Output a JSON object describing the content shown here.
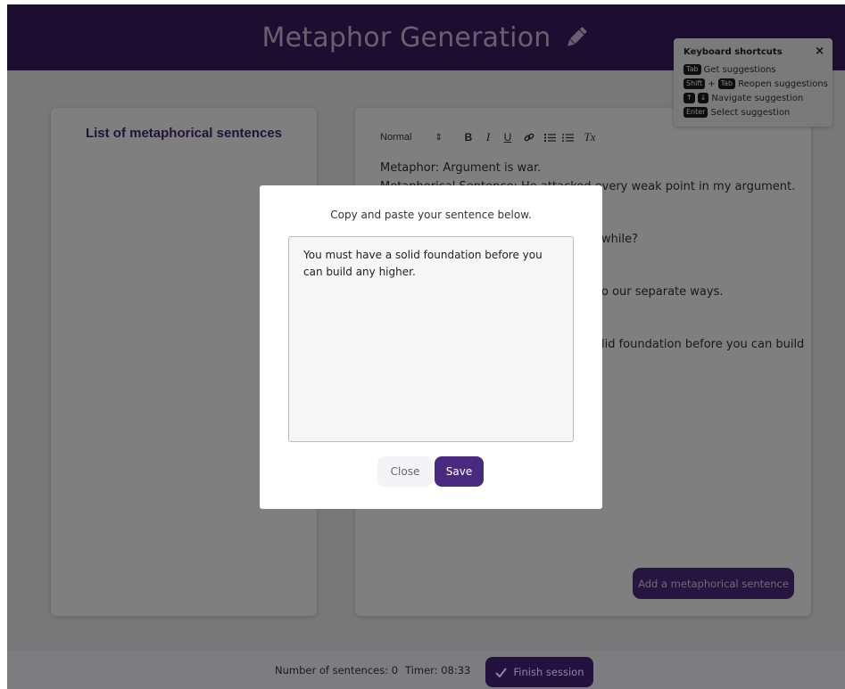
{
  "header": {
    "title": "Metaphor Generation",
    "icon": "pencil-icon"
  },
  "left_panel": {
    "title": "List of metaphorical sentences"
  },
  "editor": {
    "toolbar": {
      "format_label": "Normal",
      "bold_label": "B",
      "italic_label": "I",
      "underline_label": "U",
      "clear_format_label": "Tx"
    },
    "lines": [
      "Metaphor: Argument is war.",
      "Metaphorical Sentence: He attacked every weak point in my argument.",
      "while?",
      "o our separate ways.",
      "lid foundation before you can build"
    ],
    "add_button_label": "Add a metaphorical sentence"
  },
  "shortcuts": {
    "title": "Keyboard shortcuts",
    "close_label": "×",
    "items": [
      {
        "keys": [
          "Tab"
        ],
        "description": "Get suggestions"
      },
      {
        "keys": [
          "Shift",
          "Tab"
        ],
        "joiner": "+",
        "description": "Reopen suggestions"
      },
      {
        "keys": [
          "↑",
          "↓"
        ],
        "description": "Navigate suggestion"
      },
      {
        "keys": [
          "Enter"
        ],
        "description": "Select suggestion"
      }
    ]
  },
  "modal": {
    "title": "Copy and paste your sentence below.",
    "textarea_value": "You must have a solid foundation before you can build any higher.",
    "close_label": "Close",
    "save_label": "Save"
  },
  "footer": {
    "sentence_count_text": "Number of sentences: 0",
    "timer_text": "Timer: 08:33",
    "finish_label": "Finish session"
  },
  "colors": {
    "brand": "#3a1d63",
    "button": "#4a2a80",
    "left_title": "#3c2a75"
  }
}
